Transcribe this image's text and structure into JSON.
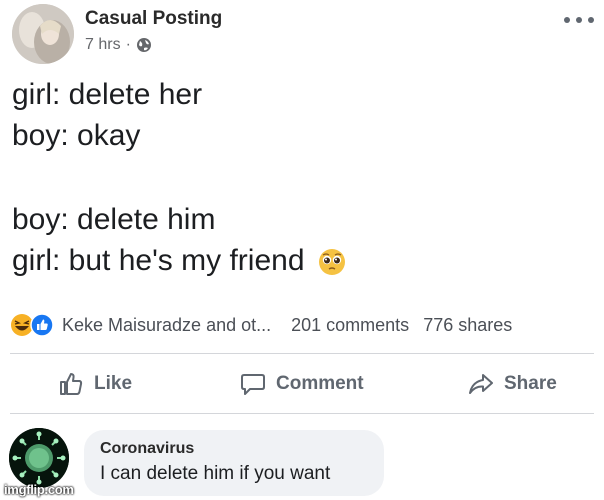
{
  "post": {
    "author": "Casual Posting",
    "time": "7 hrs",
    "separator": "·",
    "lines": [
      "girl: delete her",
      "boy: okay",
      "boy: delete him",
      "girl: but he's my friend"
    ]
  },
  "stats": {
    "reactors": "Keke Maisuradze and ot...",
    "comments": "201 comments",
    "shares": "776 shares"
  },
  "actions": {
    "like": "Like",
    "comment": "Comment",
    "share": "Share"
  },
  "comment": {
    "author": "Coronavirus",
    "text": "I can delete him if you want"
  },
  "icons": {
    "avatar": "profile-photo",
    "globe": "globe-icon",
    "more": "more-options-icon",
    "emoji": "pleading-face-emoji",
    "reactions": [
      "haha-reaction-icon",
      "like-reaction-icon"
    ],
    "like": "thumbs-up-icon",
    "comment": "comment-bubble-icon",
    "share": "share-arrow-icon",
    "comment_avatar": "virus-photo"
  },
  "colors": {
    "like_blue": "#1877f2",
    "haha_yellow": "#f7b125",
    "muted_text": "#65676b",
    "bubble_bg": "#f0f2f5"
  },
  "watermark": "imgflip.com"
}
